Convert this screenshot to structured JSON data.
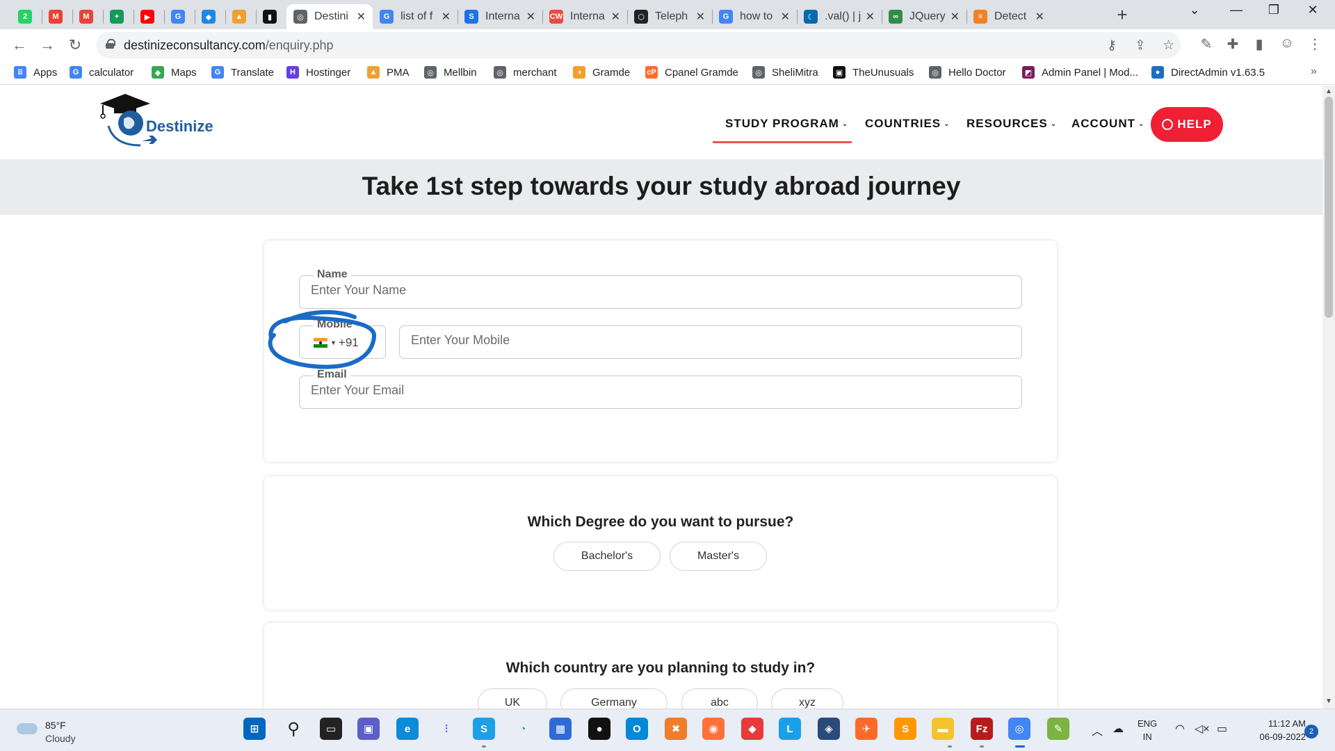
{
  "browser": {
    "tabs": [
      {
        "title": "",
        "icon": "whatsapp-icon",
        "color": "#25d366",
        "glyph": "2"
      },
      {
        "title": "",
        "icon": "gmail-icon",
        "color": "#ea4335",
        "glyph": "M"
      },
      {
        "title": "",
        "icon": "gmail-icon",
        "color": "#ea4335",
        "glyph": "M"
      },
      {
        "title": "",
        "icon": "sheets-icon",
        "color": "#0f9d58",
        "glyph": "+"
      },
      {
        "title": "",
        "icon": "youtube-icon",
        "color": "#ff0000",
        "glyph": "▶"
      },
      {
        "title": "",
        "icon": "translate-icon",
        "color": "#4285f4",
        "glyph": "G"
      },
      {
        "title": "",
        "icon": "diamond-icon",
        "color": "#1e88e5",
        "glyph": "◆"
      },
      {
        "title": "",
        "icon": "pma-icon",
        "color": "#f0a030",
        "glyph": "▲"
      },
      {
        "title": "",
        "icon": "terminal-icon",
        "color": "#111111",
        "glyph": "▮"
      },
      {
        "title": "Destini",
        "icon": "globe-icon",
        "color": "#5f6368",
        "glyph": "◎",
        "active": true
      },
      {
        "title": "list of f",
        "icon": "google-icon",
        "color": "#4285f4",
        "glyph": "G"
      },
      {
        "title": "Interna",
        "icon": "s-icon",
        "color": "#1a73e8",
        "glyph": "S"
      },
      {
        "title": "Interna",
        "icon": "cw-icon",
        "color": "#e84c3d",
        "glyph": "CW"
      },
      {
        "title": "Teleph",
        "icon": "codepen-icon",
        "color": "#222222",
        "glyph": "⬡"
      },
      {
        "title": "how to",
        "icon": "google-icon",
        "color": "#4285f4",
        "glyph": "G"
      },
      {
        "title": ".val() | j",
        "icon": "jquery-icon",
        "color": "#0769ad",
        "glyph": "☾"
      },
      {
        "title": "JQuery",
        "icon": "gfg-icon",
        "color": "#2f8d46",
        "glyph": "∞"
      },
      {
        "title": "Detect",
        "icon": "stackoverflow-icon",
        "color": "#f48024",
        "glyph": "≡"
      }
    ],
    "new_tab_label": "+",
    "url_host": "destinizeconsultancy.com",
    "url_path": "/enquiry.php",
    "bookmarks": [
      {
        "label": "Apps",
        "icon": "apps-grid-icon",
        "color": "#4285f4",
        "glyph": "⠿"
      },
      {
        "label": "calculator",
        "icon": "google-icon",
        "color": "#4285f4",
        "glyph": "G"
      },
      {
        "label": "Maps",
        "icon": "maps-icon",
        "color": "#34a853",
        "glyph": "◆"
      },
      {
        "label": "Translate",
        "icon": "translate-icon",
        "color": "#4285f4",
        "glyph": "G"
      },
      {
        "label": "Hostinger",
        "icon": "hostinger-icon",
        "color": "#673de6",
        "glyph": "H"
      },
      {
        "label": "PMA",
        "icon": "pma-icon",
        "color": "#f0a030",
        "glyph": "▲"
      },
      {
        "label": "Mellbin",
        "icon": "globe-icon",
        "color": "#5f6368",
        "glyph": "◎"
      },
      {
        "label": "merchant",
        "icon": "globe-icon",
        "color": "#5f6368",
        "glyph": "◎"
      },
      {
        "label": "Gramde",
        "icon": "gramde-icon",
        "color": "#f0a030",
        "glyph": "◑"
      },
      {
        "label": "Cpanel Gramde",
        "icon": "cpanel-icon",
        "color": "#ff6c2c",
        "glyph": "cP"
      },
      {
        "label": "SheliMitra",
        "icon": "globe-icon",
        "color": "#5f6368",
        "glyph": "◎"
      },
      {
        "label": "TheUnusuals",
        "icon": "unusuals-icon",
        "color": "#111111",
        "glyph": "▣"
      },
      {
        "label": "Hello Doctor",
        "icon": "globe-icon",
        "color": "#5f6368",
        "glyph": "◎"
      },
      {
        "label": "Admin Panel | Mod...",
        "icon": "admin-panel-icon",
        "color": "#7a1f5c",
        "glyph": "◩"
      },
      {
        "label": "DirectAdmin v1.63.5",
        "icon": "directadmin-icon",
        "color": "#1a6fc2",
        "glyph": "●"
      }
    ]
  },
  "site": {
    "logo_text": "Destinize",
    "nav": [
      {
        "label": "STUDY PROGRAM",
        "active": true
      },
      {
        "label": "COUNTRIES"
      },
      {
        "label": "RESOURCES"
      },
      {
        "label": "ACCOUNT"
      }
    ],
    "help_label": "HELP",
    "hero_title": "Take 1st step towards your study abroad journey",
    "form": {
      "name_label": "Name",
      "name_placeholder": "Enter Your Name",
      "mobile_label": "Mobile",
      "country_code": "+91",
      "mobile_placeholder": "Enter Your Mobile",
      "email_label": "Email",
      "email_placeholder": "Enter Your Email"
    },
    "degree_question": "Which Degree do you want to pursue?",
    "degree_options": [
      "Bachelor's",
      "Master's"
    ],
    "country_question": "Which country are you planning to study in?",
    "country_options": [
      "UK",
      "Germany",
      "abc",
      "xyz"
    ],
    "accent_color": "#f01f33",
    "brand_color": "#1f5e9e"
  },
  "taskbar": {
    "weather_temp": "85°F",
    "weather_cond": "Cloudy",
    "lang_line1": "ENG",
    "lang_line2": "IN",
    "time": "11:12 AM",
    "date": "06-09-2022",
    "notifications": "2"
  }
}
